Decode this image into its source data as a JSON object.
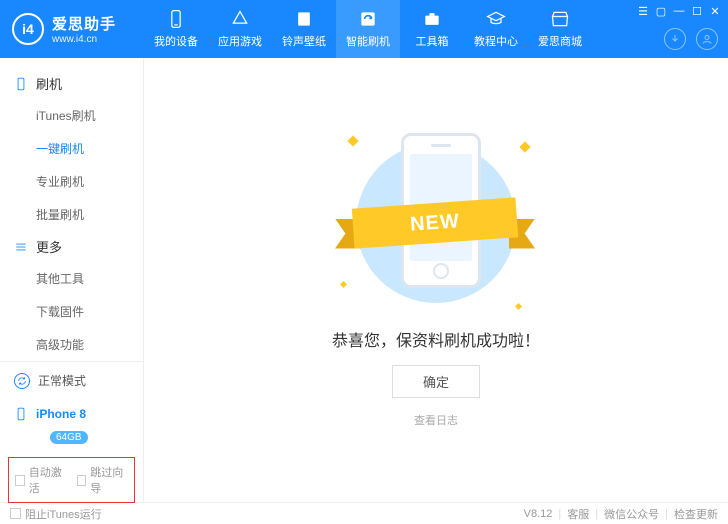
{
  "logo": {
    "mark": "i4",
    "name": "爱思助手",
    "url": "www.i4.cn"
  },
  "nav": [
    {
      "key": "device",
      "label": "我的设备"
    },
    {
      "key": "apps",
      "label": "应用游戏"
    },
    {
      "key": "ringtone",
      "label": "铃声壁纸"
    },
    {
      "key": "flash",
      "label": "智能刷机"
    },
    {
      "key": "toolbox",
      "label": "工具箱"
    },
    {
      "key": "tutorial",
      "label": "教程中心"
    },
    {
      "key": "store",
      "label": "爱思商城"
    }
  ],
  "nav_active_index": 3,
  "sidebar": {
    "group1": {
      "title": "刷机"
    },
    "group1_items": [
      {
        "label": "iTunes刷机"
      },
      {
        "label": "一键刷机"
      },
      {
        "label": "专业刷机"
      },
      {
        "label": "批量刷机"
      }
    ],
    "group1_active_index": 1,
    "group2": {
      "title": "更多"
    },
    "group2_items": [
      {
        "label": "其他工具"
      },
      {
        "label": "下载固件"
      },
      {
        "label": "高级功能"
      }
    ],
    "status": {
      "label": "正常模式"
    },
    "device": {
      "name": "iPhone 8",
      "storage": "64GB"
    },
    "checks": {
      "auto_activate": "自动激活",
      "skip_guide": "跳过向导"
    }
  },
  "main": {
    "ribbon": "NEW",
    "message": "恭喜您，保资料刷机成功啦！",
    "ok": "确定",
    "log": "查看日志"
  },
  "footer": {
    "block_itunes": "阻止iTunes运行",
    "version": "V8.12",
    "support": "客服",
    "wechat": "微信公众号",
    "update": "检查更新"
  }
}
